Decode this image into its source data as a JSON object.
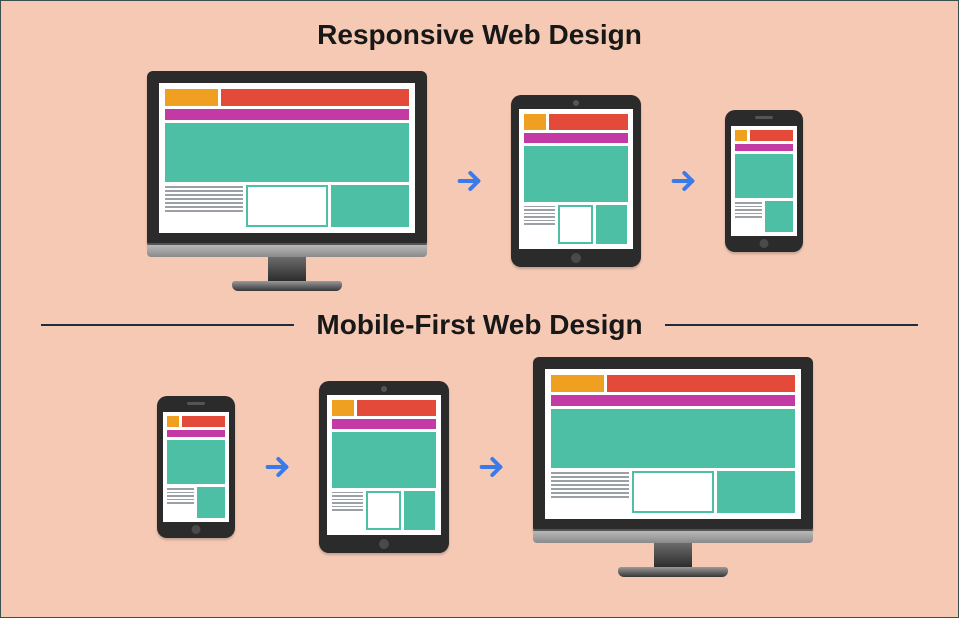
{
  "titles": {
    "responsive": "Responsive Web Design",
    "mobile_first": "Mobile-First Web Design"
  },
  "flows": {
    "responsive": [
      "desktop",
      "tablet",
      "phone"
    ],
    "mobile_first": [
      "phone",
      "tablet",
      "desktop"
    ]
  },
  "icons": {
    "arrow": "arrow-right"
  },
  "colors": {
    "background": "#f5c9b4",
    "accent_arrow": "#3a7aea",
    "divider": "#1f2d3d",
    "layout": {
      "logo": "#f0a020",
      "banner": "#e34a3a",
      "nav": "#c43aa5",
      "block": "#4cbfa4"
    }
  }
}
